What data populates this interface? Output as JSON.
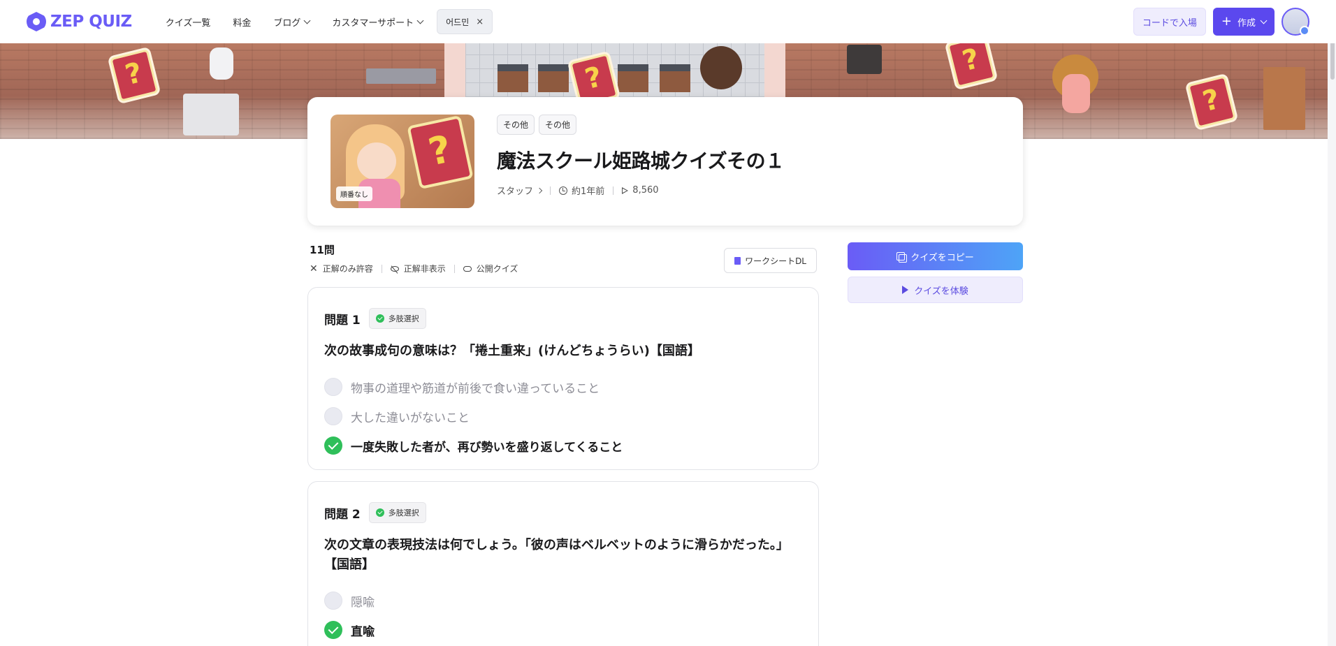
{
  "header": {
    "logo_text": "ZEP QUIZ",
    "nav": [
      {
        "label": "クイズ一覧"
      },
      {
        "label": "料金"
      },
      {
        "label": "ブログ"
      },
      {
        "label": "カスタマーサポート"
      }
    ],
    "chip_label": "어드민",
    "chip_close": "×",
    "code_button": "コードで入場",
    "create_button": "作成",
    "create_plus": "+"
  },
  "quiz": {
    "thumbnail_tag": "順番なし",
    "categories": [
      "その他",
      "その他"
    ],
    "title": "魔法スクール姫路城クイズその１",
    "author": "スタッフ",
    "time": "約1年前",
    "plays": "8,560"
  },
  "summary": {
    "count": "11問",
    "flags": [
      "正解のみ許容",
      "正解非表示",
      "公開クイズ"
    ],
    "worksheet_button": "ワークシートDL"
  },
  "actions": {
    "copy_button": "クイズをコピー",
    "try_button": "クイズを体験"
  },
  "questions": [
    {
      "num": "問題 1",
      "type": "多肢選択",
      "text": "次の故事成句の意味は？「捲土重来」(けんどちょうらい)【国語】",
      "options": [
        {
          "text": "物事の道理や筋道が前後で食い違っていること",
          "correct": false
        },
        {
          "text": "大した違いがないこと",
          "correct": false
        },
        {
          "text": "一度失敗した者が、再び勢いを盛り返してくること",
          "correct": true
        }
      ]
    },
    {
      "num": "問題 2",
      "type": "多肢選択",
      "text": "次の文章の表現技法は何でしょう。「彼の声はベルベットのように滑らかだった。」【国語】",
      "options": [
        {
          "text": "隠喩",
          "correct": false
        },
        {
          "text": "直喩",
          "correct": true
        }
      ]
    }
  ],
  "colors": {
    "brand": "#6a5cf6",
    "correct": "#2fbf5a"
  }
}
